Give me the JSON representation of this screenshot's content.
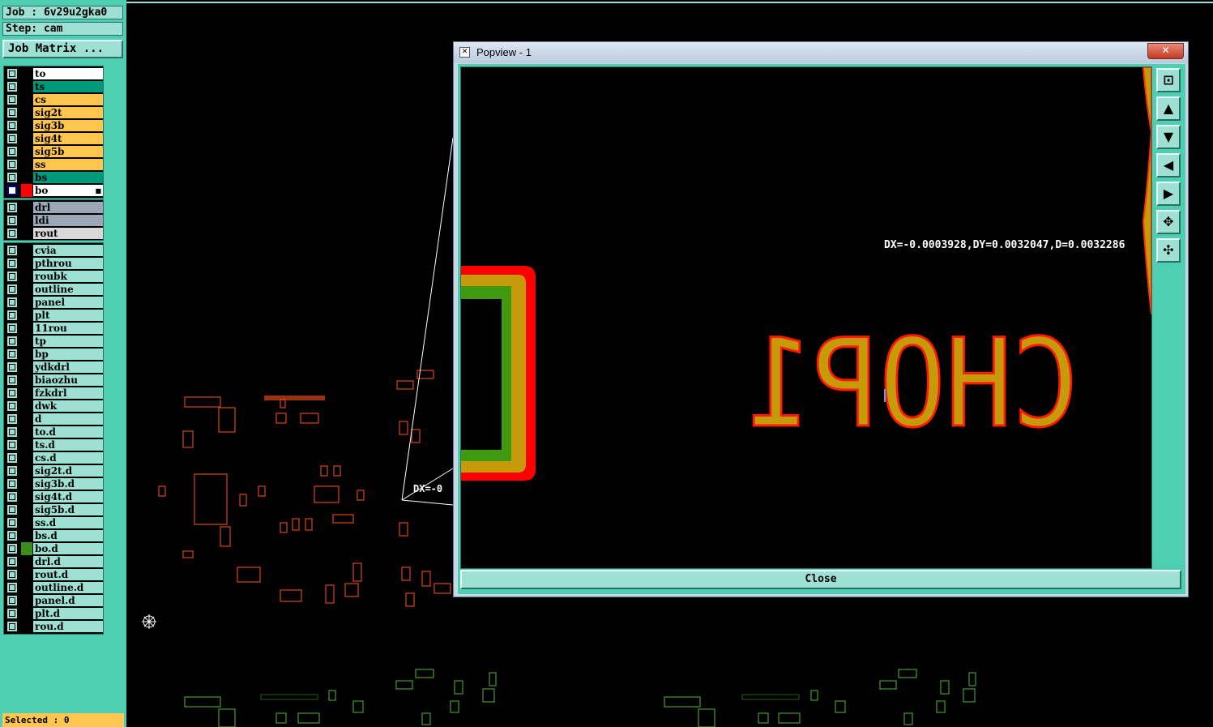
{
  "job": {
    "label": "Job : 6v29u2gka0",
    "step": "Step: cam",
    "matrix_button": "Job Matrix ..."
  },
  "layers": [
    {
      "name": "to",
      "color": "#ffffff"
    },
    {
      "name": "ts",
      "color": "#00997a"
    },
    {
      "name": "cs",
      "color": "#fec64f"
    },
    {
      "name": "sig2t",
      "color": "#fec64f"
    },
    {
      "name": "sig3b",
      "color": "#fec64f"
    },
    {
      "name": "sig4t",
      "color": "#fec64f"
    },
    {
      "name": "sig5b",
      "color": "#fec64f"
    },
    {
      "name": "ss",
      "color": "#fec64f"
    },
    {
      "name": "bs",
      "color": "#00997a"
    },
    {
      "name": "bo",
      "color": "#ffffff",
      "selected": true,
      "swatch": "#ff0000"
    }
  ],
  "drill_layers": [
    {
      "name": "drl",
      "color": "#9aa8b8"
    },
    {
      "name": "ldi",
      "color": "#9aa8b8"
    },
    {
      "name": "rout",
      "color": "#d8d8d8"
    }
  ],
  "other_layers": [
    {
      "name": "cvia"
    },
    {
      "name": "pthrou"
    },
    {
      "name": "roubk"
    },
    {
      "name": "outline"
    },
    {
      "name": "panel"
    },
    {
      "name": "plt"
    },
    {
      "name": "11rou"
    },
    {
      "name": "tp"
    },
    {
      "name": "bp"
    },
    {
      "name": "ydkdrl"
    },
    {
      "name": "biaozhu"
    },
    {
      "name": "fzkdrl"
    },
    {
      "name": "dwk"
    },
    {
      "name": "d"
    },
    {
      "name": "to.d"
    },
    {
      "name": "ts.d"
    },
    {
      "name": "cs.d"
    },
    {
      "name": "sig2t.d"
    },
    {
      "name": "sig3b.d"
    },
    {
      "name": "sig4t.d"
    },
    {
      "name": "sig5b.d"
    },
    {
      "name": "ss.d"
    },
    {
      "name": "bs.d"
    },
    {
      "name": "bo.d",
      "swatch": "#3a8c1e"
    },
    {
      "name": "drl.d"
    },
    {
      "name": "rout.d"
    },
    {
      "name": "outline.d"
    },
    {
      "name": "panel.d"
    },
    {
      "name": "plt.d"
    },
    {
      "name": "rou.d"
    }
  ],
  "colors": {
    "panel_bg": "#4ecfb2",
    "layer_name_bg": "#9ee0d4",
    "signal_color": "#fec64f"
  },
  "status": {
    "selected": "Selected : 0"
  },
  "popview": {
    "title": "Popview - 1",
    "close_x": "✕",
    "measurement": "DX=-0.0003928,DY=0.0032047,D=0.0032286",
    "silkscreen_text": "CHOP1",
    "close_label": "Close",
    "tools": [
      {
        "name": "zoom-home-icon",
        "glyph": "⊡"
      },
      {
        "name": "pan-up-icon",
        "glyph": "▲"
      },
      {
        "name": "pan-down-icon",
        "glyph": "▼"
      },
      {
        "name": "pan-left-icon",
        "glyph": "◀"
      },
      {
        "name": "pan-right-icon",
        "glyph": "▶"
      },
      {
        "name": "zoom-fit-icon",
        "glyph": "✥"
      },
      {
        "name": "zoom-out-icon",
        "glyph": "✣"
      }
    ]
  },
  "main_canvas": {
    "measure_fragment": "DX=-0"
  }
}
